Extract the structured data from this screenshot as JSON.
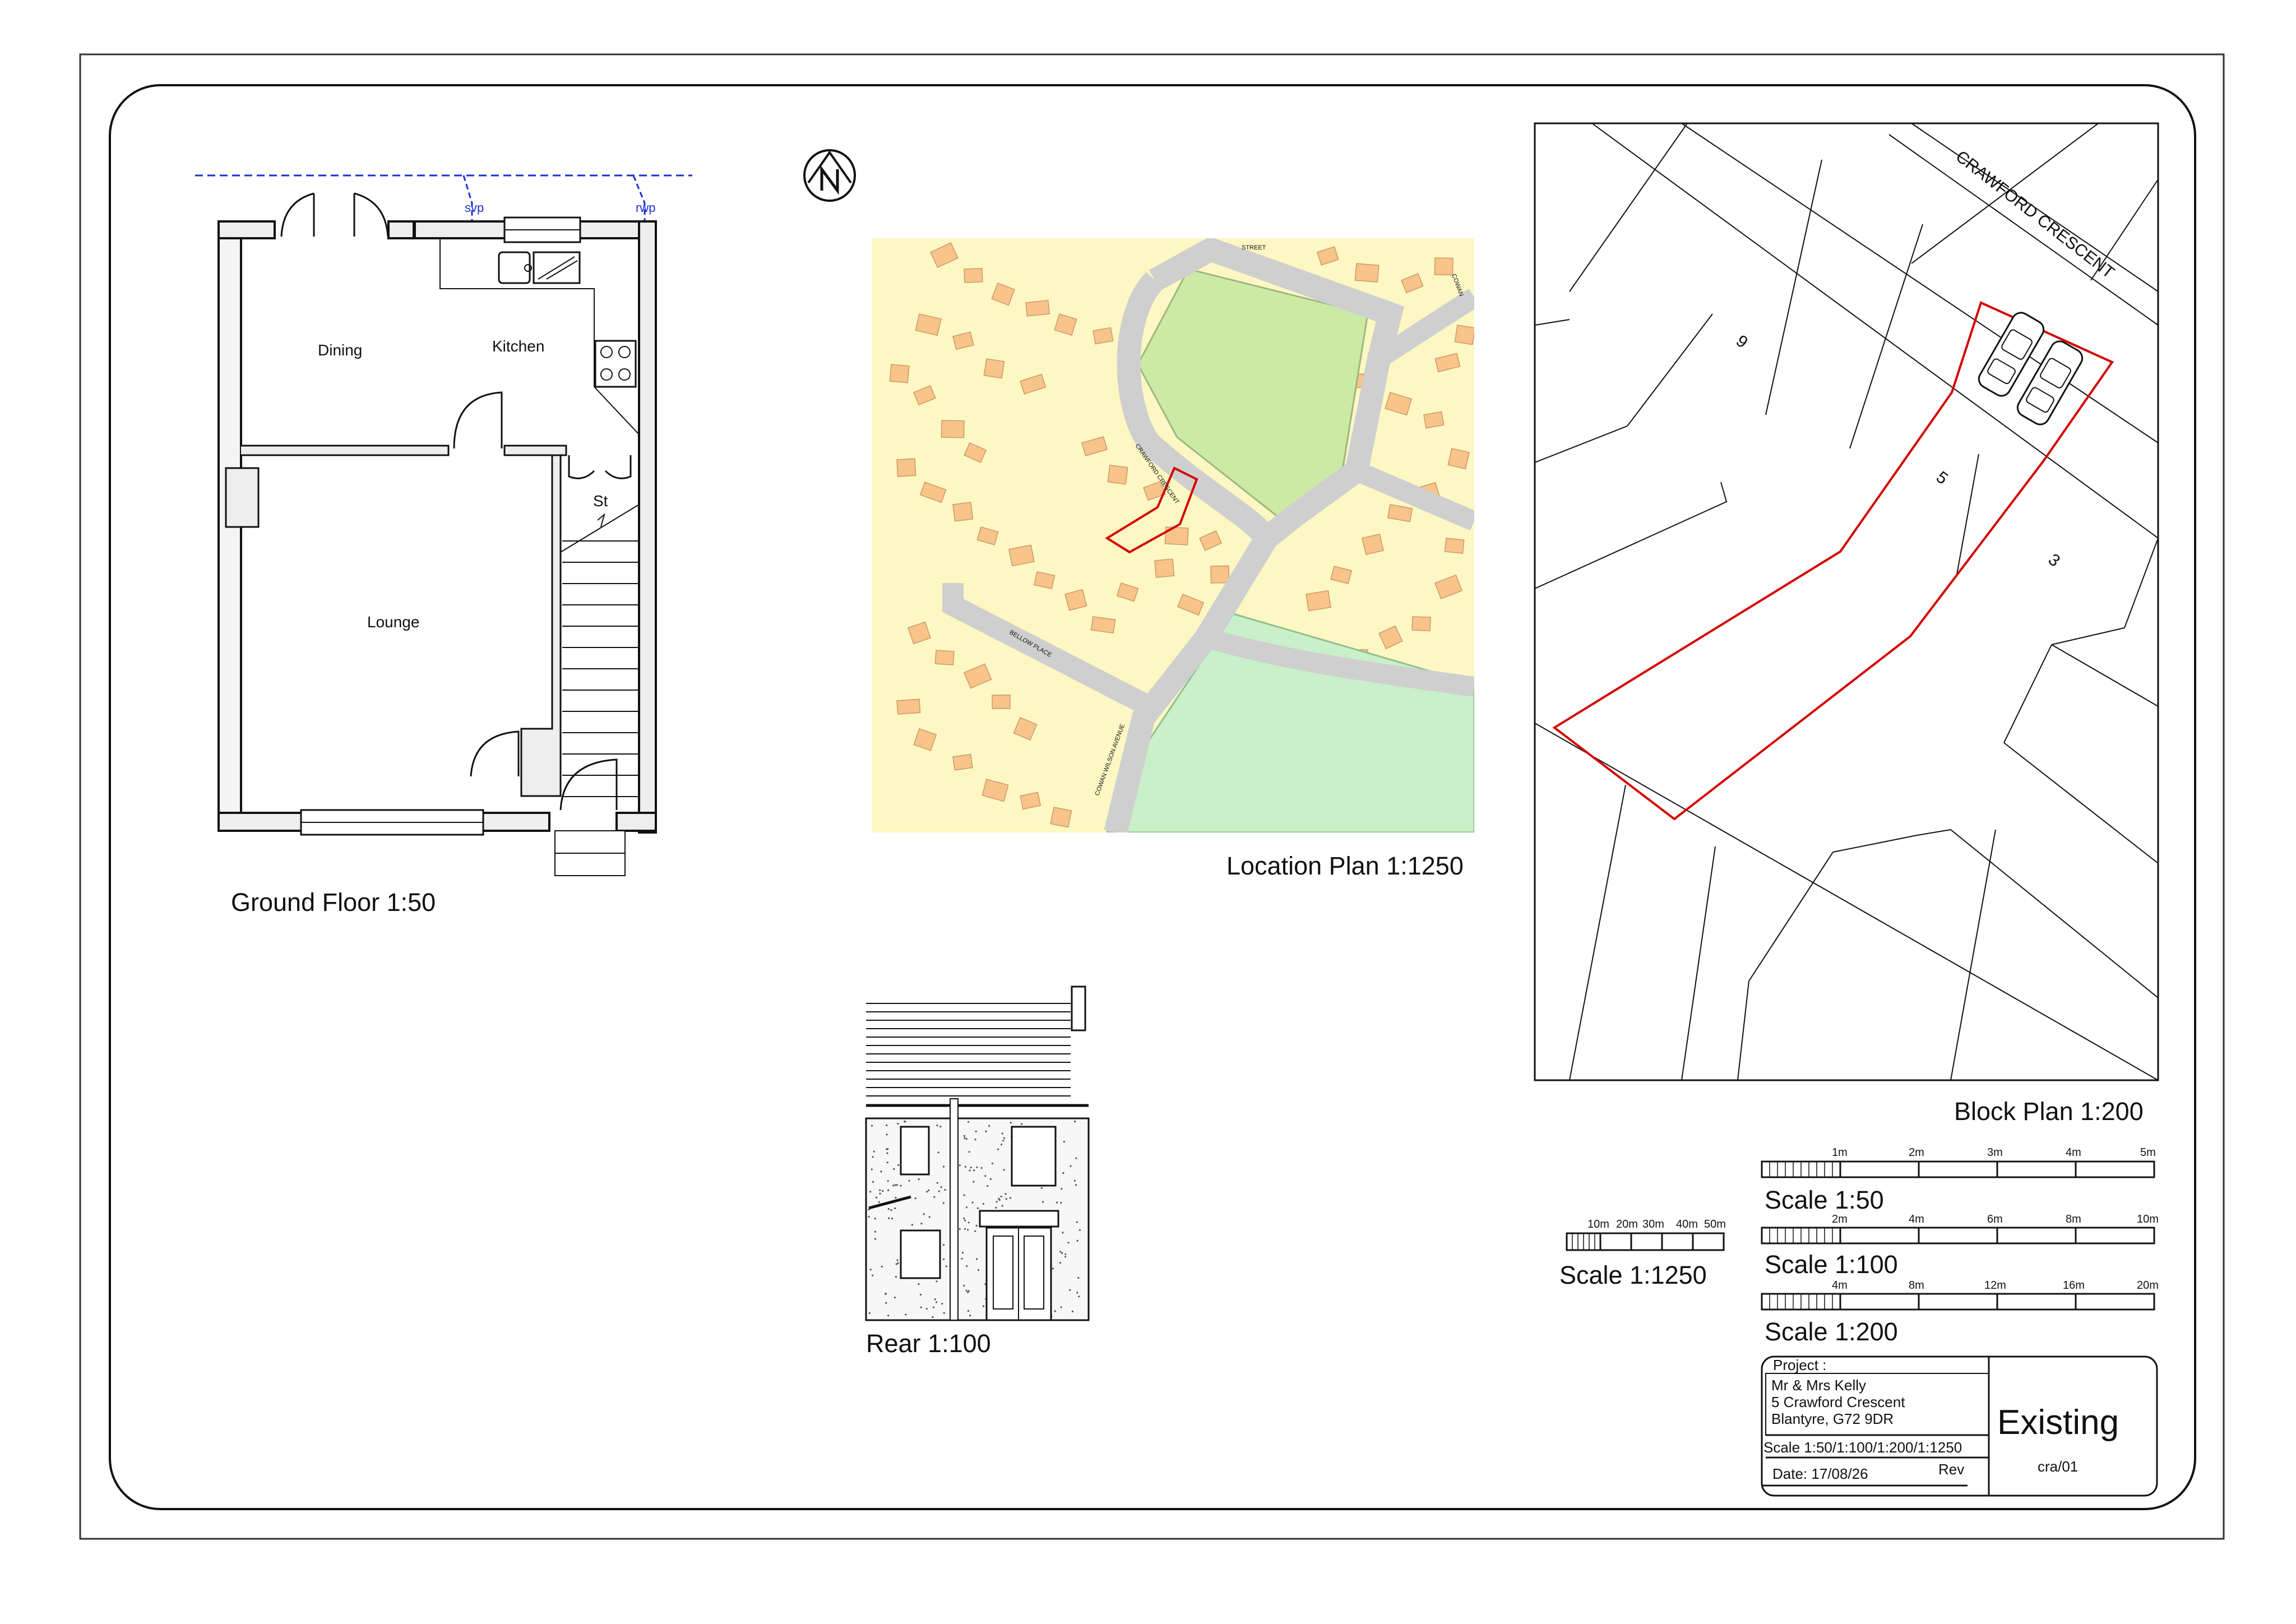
{
  "ground_floor": {
    "title": "Ground Floor 1:50",
    "rooms": {
      "dining": "Dining",
      "kitchen": "Kitchen",
      "lounge": "Lounge",
      "store": "St"
    },
    "svp_left": "svp",
    "svp_right": "rwp"
  },
  "location_plan": {
    "title": "Location Plan 1:1250",
    "streets": [
      "CRAWFORD CRESCENT",
      "BELLOW PLACE",
      "COWAN WILSON AVENUE",
      "STREET",
      "COWAN"
    ]
  },
  "block_plan": {
    "title": "Block Plan 1:200",
    "street": "CRAWFORD CRESCENT",
    "plots": {
      "a": "9",
      "b": "5",
      "c": "3"
    }
  },
  "rear": {
    "title": "Rear 1:100"
  },
  "scales": {
    "s1250": {
      "label": "Scale 1:1250",
      "ticks": [
        "10m",
        "20m",
        "30m",
        "40m",
        "50m"
      ]
    },
    "s50": {
      "label": "Scale 1:50",
      "ticks": [
        "1m",
        "2m",
        "3m",
        "4m",
        "5m"
      ]
    },
    "s100": {
      "label": "Scale 1:100",
      "ticks": [
        "2m",
        "4m",
        "6m",
        "8m",
        "10m"
      ]
    },
    "s200": {
      "label": "Scale 1:200",
      "ticks": [
        "4m",
        "8m",
        "12m",
        "16m",
        "20m"
      ]
    }
  },
  "title_block": {
    "project_label": "Project :",
    "client": "Mr & Mrs Kelly",
    "address1": "5 Crawford Crescent",
    "address2": "Blantyre, G72 9DR",
    "scale": "Scale 1:50/1:100/1:200/1:1250",
    "date": "Date: 17/08/26",
    "rev": "Rev",
    "status": "Existing",
    "drawing_no": "cra/01"
  },
  "colors": {
    "line": "#222222",
    "red": "#d40000",
    "blue": "#1a2fd6",
    "map_bg": "#fdf7c3",
    "house": "#f8c48a",
    "road": "#cfcfcf",
    "green": "#cde9a6",
    "green2": "#c9f0c9"
  }
}
